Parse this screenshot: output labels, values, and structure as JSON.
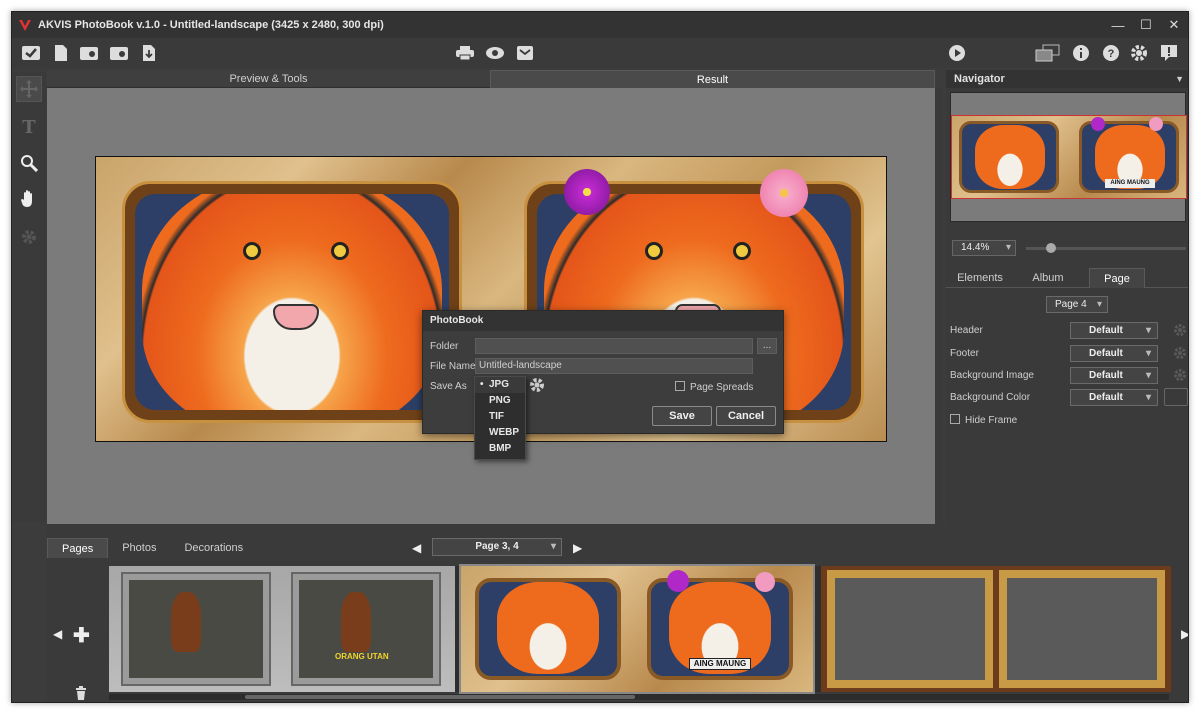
{
  "window": {
    "title": "AKVIS PhotoBook v.1.0 - Untitled-landscape (3425 x 2480, 300 dpi)"
  },
  "view_tabs": [
    "Preview & Tools",
    "Result"
  ],
  "dialog": {
    "title": "PhotoBook",
    "folder_label": "Folder",
    "folder_value": "",
    "browse_label": "...",
    "filename_label": "File Name",
    "filename_value": "Untitled-landscape",
    "saveas_label": "Save As",
    "page_spreads_label": "Page Spreads",
    "save_label": "Save",
    "cancel_label": "Cancel",
    "formats": [
      "JPG",
      "PNG",
      "TIF",
      "WEBP",
      "BMP"
    ],
    "selected_format": "JPG"
  },
  "navigator": {
    "title": "Navigator",
    "zoom": "14.4%",
    "caption": "AING MAUNG"
  },
  "right_tabs": [
    "Elements",
    "Album",
    "Page"
  ],
  "page_panel": {
    "page_select": "Page 4",
    "rows": [
      {
        "label": "Header",
        "value": "Default"
      },
      {
        "label": "Footer",
        "value": "Default"
      },
      {
        "label": "Background Image",
        "value": "Default"
      },
      {
        "label": "Background Color",
        "value": "Default"
      }
    ],
    "hide_frame": "Hide Frame"
  },
  "bottom": {
    "tabs": [
      "Pages",
      "Photos",
      "Decorations"
    ],
    "page_nav": "Page 3, 4",
    "thumb1_caption": "ORANG UTAN",
    "thumb2_caption": "AING MAUNG"
  },
  "colors": {
    "accent": "#c33333",
    "panel": "#3a3a3a",
    "canvas": "#7b7b7b"
  }
}
